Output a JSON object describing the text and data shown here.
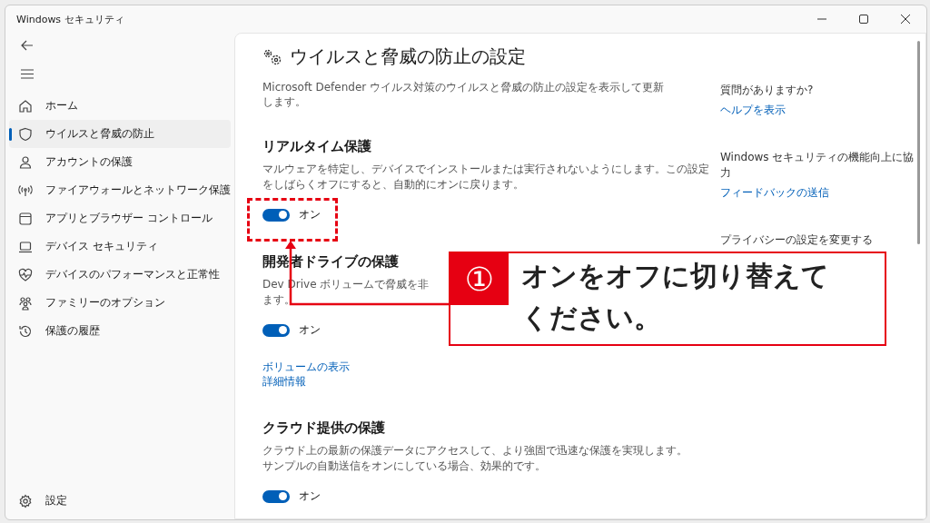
{
  "window": {
    "title": "Windows セキュリティ"
  },
  "sidebar": {
    "items": [
      {
        "label": "ホーム",
        "selected": false
      },
      {
        "label": "ウイルスと脅威の防止",
        "selected": true
      },
      {
        "label": "アカウントの保護",
        "selected": false
      },
      {
        "label": "ファイアウォールとネットワーク保護",
        "selected": false
      },
      {
        "label": "アプリとブラウザー コントロール",
        "selected": false
      },
      {
        "label": "デバイス セキュリティ",
        "selected": false
      },
      {
        "label": "デバイスのパフォーマンスと正常性",
        "selected": false
      },
      {
        "label": "ファミリーのオプション",
        "selected": false
      },
      {
        "label": "保護の履歴",
        "selected": false
      }
    ],
    "settings": "設定"
  },
  "page": {
    "title": "ウイルスと脅威の防止の設定",
    "description": [
      "Microsoft Defender ウイルス対策のウイルスと脅威の防止の設定を表示して更新",
      "します。"
    ]
  },
  "sections": [
    {
      "heading": "リアルタイム保護",
      "description": [
        "マルウェアを特定し、デバイスでインストールまたは実行されないようにします。この設定",
        "をしばらくオフにすると、自動的にオンに戻ります。"
      ],
      "toggle": {
        "on": true,
        "label": "オン"
      }
    },
    {
      "heading": "開発者ドライブの保護",
      "description": [
        "Dev Drive ボリュームで脅威を非",
        "ます。"
      ],
      "toggle": {
        "on": true,
        "label": "オン"
      },
      "links": [
        "ボリュームの表示",
        "詳細情報"
      ]
    },
    {
      "heading": "クラウド提供の保護",
      "description": [
        "クラウド上の最新の保護データにアクセスして、より強固で迅速な保護を実現します。",
        "サンプルの自動送信をオンにしている場合、効果的です。"
      ],
      "toggle": {
        "on": true,
        "label": "オン"
      }
    }
  ],
  "aside": [
    {
      "heading": [
        "質問がありますか?"
      ],
      "links": [
        "ヘルプを表示"
      ]
    },
    {
      "heading": [
        "Windows セキュリティの機能向上に協",
        "力"
      ],
      "links": [
        "フィードバックの送信"
      ]
    },
    {
      "heading": [
        "プライバシーの設定を変更する"
      ]
    }
  ],
  "callout": {
    "number": "①",
    "lines": [
      "オンをオフに切り替えて",
      "ください。"
    ]
  }
}
